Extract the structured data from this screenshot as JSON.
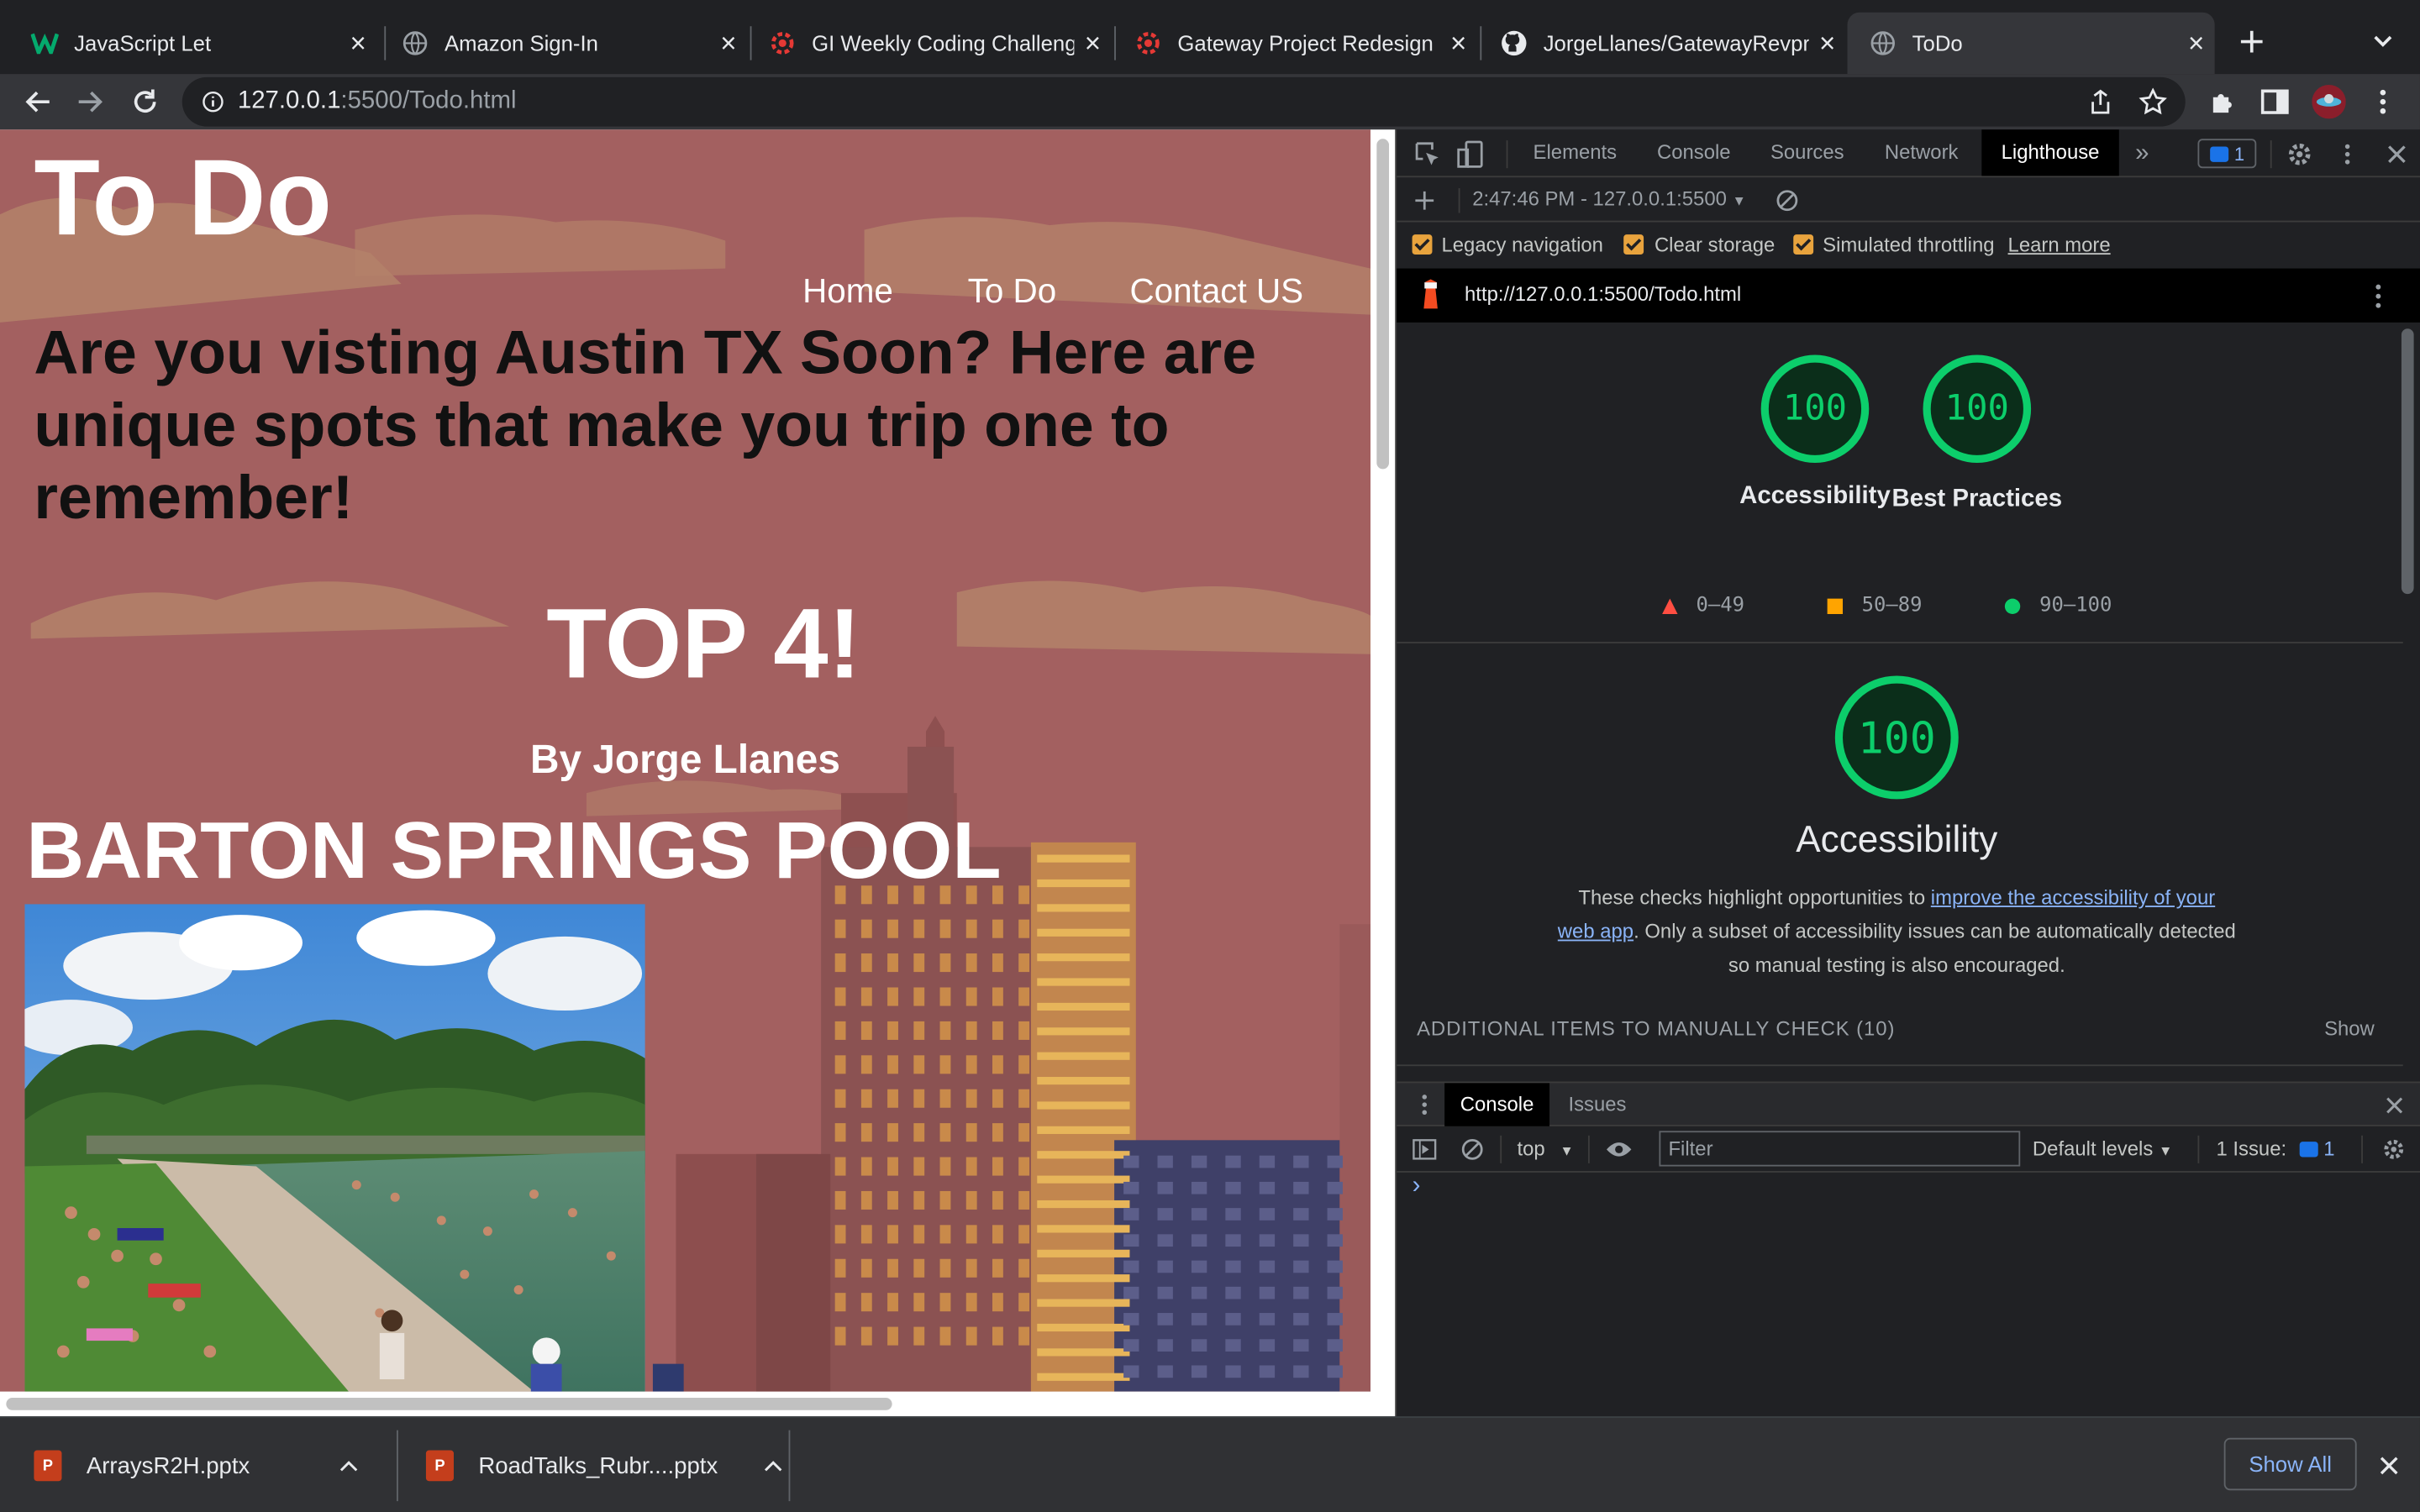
{
  "browser": {
    "tabs": [
      {
        "title": "JavaScript Let",
        "favicon": "w3schools-icon"
      },
      {
        "title": "Amazon Sign-In",
        "favicon": "globe-icon"
      },
      {
        "title": "GI Weekly Coding Challeng",
        "favicon": "gi-gear-icon"
      },
      {
        "title": "Gateway Project Redesign",
        "favicon": "gi-gear-icon"
      },
      {
        "title": "JorgeLlanes/GatewayRevpr",
        "favicon": "github-icon"
      },
      {
        "title": "ToDo",
        "favicon": "globe-icon"
      }
    ],
    "active_tab": 5,
    "url_host": "127.0.0.1",
    "url_path": ":5500/Todo.html"
  },
  "site": {
    "logo": "To Do",
    "nav": [
      "Home",
      "To Do",
      "Contact US"
    ],
    "headline": "Are you visting Austin TX Soon? Here are unique spots that make you trip one to remember!",
    "top_title": "TOP 4!",
    "byline": "By Jorge Llanes",
    "section_title": "BARTON SPRINGS POOL"
  },
  "devtools": {
    "tabs": [
      "Elements",
      "Console",
      "Sources",
      "Network",
      "Lighthouse"
    ],
    "active_tab": "Lighthouse",
    "issues_badge": "1",
    "report_selector": "2:47:46 PM - 127.0.0.1:5500",
    "options": {
      "legacy_navigation": "Legacy navigation",
      "clear_storage": "Clear storage",
      "simulated_throttling": "Simulated throttling",
      "learn_more": "Learn more"
    },
    "report_url": "http://127.0.0.1:5500/Todo.html",
    "scores": [
      {
        "label": "Accessibility",
        "score": "100"
      },
      {
        "label": "Best Practices",
        "score": "100"
      }
    ],
    "legend": [
      {
        "range": "0–49",
        "color": "#ff4e42"
      },
      {
        "range": "50–89",
        "color": "#ffa400"
      },
      {
        "range": "90–100",
        "color": "#0cce6b"
      }
    ],
    "detail_score": "100",
    "detail_title": "Accessibility",
    "description_1": "These checks highlight opportunities to ",
    "description_link": "improve the accessibility of your web app",
    "description_2": ". Only a subset of accessibility issues can be automatically detected so manual testing is also encouraged.",
    "manual_check": "ADDITIONAL ITEMS TO MANUALLY CHECK",
    "manual_count": "(10)",
    "show": "Show",
    "drawer": {
      "tabs": [
        "Console",
        "Issues"
      ],
      "context": "top",
      "filter_placeholder": "Filter",
      "levels": "Default levels",
      "issues_label": "1 Issue:",
      "issues_count": "1",
      "prompt": "›"
    }
  },
  "downloads": {
    "items": [
      "ArraysR2H.pptx",
      "RoadTalks_Rubr....pptx"
    ],
    "show_all": "Show All"
  },
  "colors": {
    "score_green": "#0cce6b",
    "lighthouse_bg": "#202124",
    "page_bg": "#a36060"
  }
}
